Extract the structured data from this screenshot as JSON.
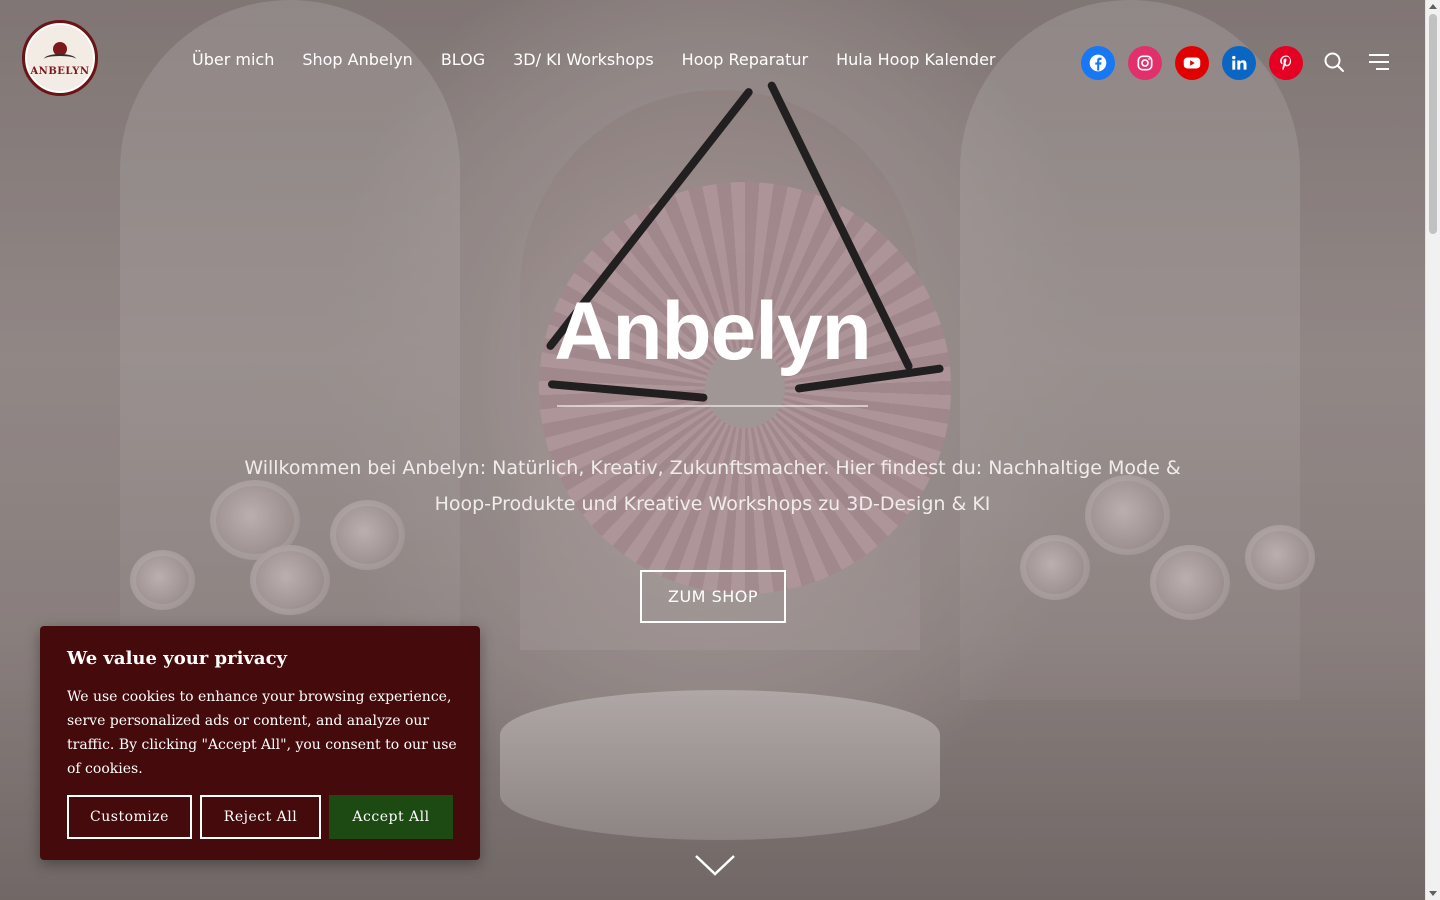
{
  "logo": {
    "text": "ANBELYN"
  },
  "nav": {
    "items": [
      {
        "label": "Über mich"
      },
      {
        "label": "Shop Anbelyn"
      },
      {
        "label": "BLOG"
      },
      {
        "label": "3D/ KI Workshops"
      },
      {
        "label": "Hoop Reparatur"
      },
      {
        "label": "Hula Hoop Kalender"
      }
    ]
  },
  "social": {
    "items": [
      {
        "name": "facebook-icon",
        "glyph": "f",
        "color": "#1877f2"
      },
      {
        "name": "instagram-icon",
        "glyph": "◎",
        "color": "#e1306c"
      },
      {
        "name": "youtube-icon",
        "glyph": "▶",
        "color": "#ff0000"
      },
      {
        "name": "linkedin-icon",
        "glyph": "in",
        "color": "#0a66c2"
      },
      {
        "name": "pinterest-icon",
        "glyph": "P",
        "color": "#e60023"
      }
    ]
  },
  "hero": {
    "title": "Anbelyn",
    "text": "Willkommen bei Anbelyn: Natürlich, Kreativ, Zukunftsmacher. Hier findest du: Nachhaltige Mode & Hoop-Produkte und Kreative Workshops zu 3D-Design & KI",
    "cta_label": "ZUM SHOP"
  },
  "cookie": {
    "title": "We value your privacy",
    "text": "We use cookies to enhance your browsing experience, serve personalized ads or content, and analyze our traffic. By clicking \"Accept All\", you consent to our use of cookies.",
    "customize_label": "Customize",
    "reject_label": "Reject All",
    "accept_label": "Accept All",
    "background_color": "#450a0c",
    "accept_color": "#1c4a12"
  }
}
